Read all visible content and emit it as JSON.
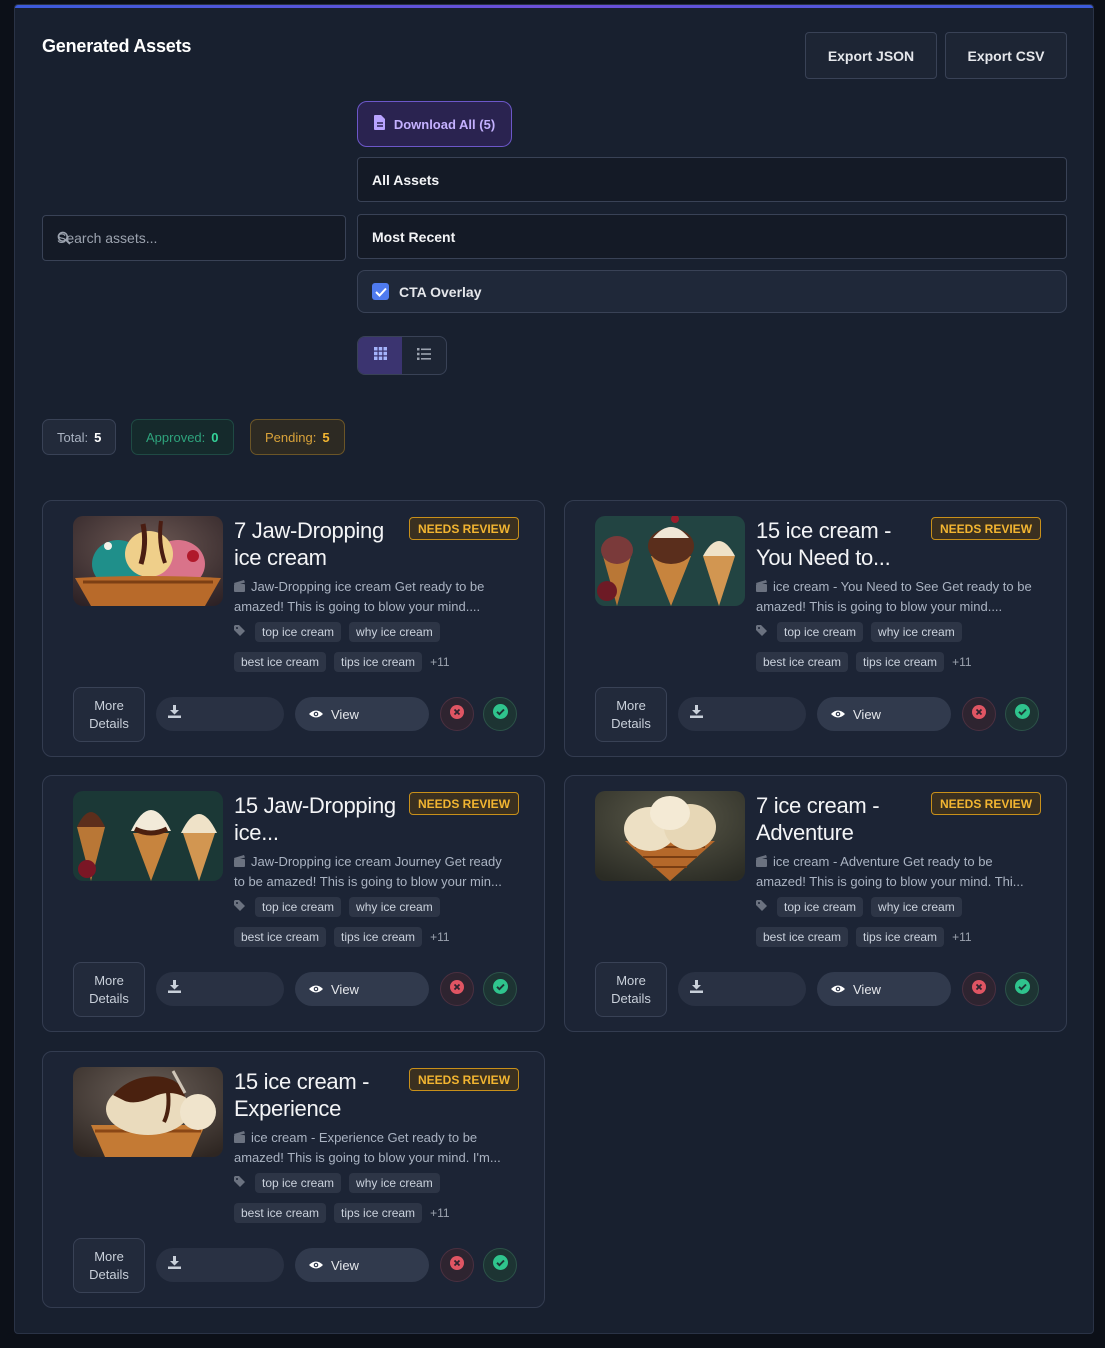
{
  "header": {
    "title": "Generated Assets",
    "export_json": "Export JSON",
    "export_csv": "Export CSV"
  },
  "toolbar": {
    "download_all": "Download All (5)",
    "search_placeholder": "Search assets...",
    "filter_selected": "All Assets",
    "sort_selected": "Most Recent",
    "cta_overlay_label": "CTA Overlay",
    "cta_overlay_checked": true,
    "view_mode": "grid"
  },
  "stats": {
    "total_label": "Total:",
    "total_value": "5",
    "approved_label": "Approved:",
    "approved_value": "0",
    "pending_label": "Pending:",
    "pending_value": "5"
  },
  "card_labels": {
    "more_details": "More Details",
    "view": "View"
  },
  "cards": [
    {
      "title": "7 Jaw-Dropping ice cream",
      "status": "NEEDS REVIEW",
      "description": "Jaw-Dropping ice cream Get ready to be amazed! This is going to blow your mind....",
      "tags": [
        "top ice cream",
        "why ice cream",
        "best ice cream",
        "tips ice cream"
      ],
      "more_tags": "+11"
    },
    {
      "title": "15 ice cream - You Need to...",
      "status": "NEEDS REVIEW",
      "description": "ice cream - You Need to See Get ready to be amazed! This is going to blow your mind....",
      "tags": [
        "top ice cream",
        "why ice cream",
        "best ice cream",
        "tips ice cream"
      ],
      "more_tags": "+11"
    },
    {
      "title": "15 Jaw-Dropping ice...",
      "status": "NEEDS REVIEW",
      "description": "Jaw-Dropping ice cream Journey Get ready to be amazed! This is going to blow your min...",
      "tags": [
        "top ice cream",
        "why ice cream",
        "best ice cream",
        "tips ice cream"
      ],
      "more_tags": "+11"
    },
    {
      "title": "7 ice cream - Adventure",
      "status": "NEEDS REVIEW",
      "description": "ice cream - Adventure Get ready to be amazed! This is going to blow your mind. Thi...",
      "tags": [
        "top ice cream",
        "why ice cream",
        "best ice cream",
        "tips ice cream"
      ],
      "more_tags": "+11"
    },
    {
      "title": "15 ice cream - Experience",
      "status": "NEEDS REVIEW",
      "description": "ice cream - Experience Get ready to be amazed! This is going to blow your mind. I'm...",
      "tags": [
        "top ice cream",
        "why ice cream",
        "best ice cream",
        "tips ice cream"
      ],
      "more_tags": "+11"
    }
  ],
  "icons": {
    "download_all": "file-download-icon",
    "search": "search-icon",
    "checkbox": "checkbox-checked-icon",
    "grid_view": "grid-icon",
    "list_view": "list-icon",
    "description": "film-icon",
    "tags": "tag-icon",
    "download": "download-icon",
    "view": "eye-icon",
    "reject": "reject-x-icon",
    "approve": "approve-check-icon"
  },
  "colors": {
    "accent_purple": "#6c57c9",
    "approved_green": "#2ea37c",
    "pending_amber": "#d9a23a",
    "review_badge": "#f2b531",
    "reject_red": "#e05563"
  }
}
